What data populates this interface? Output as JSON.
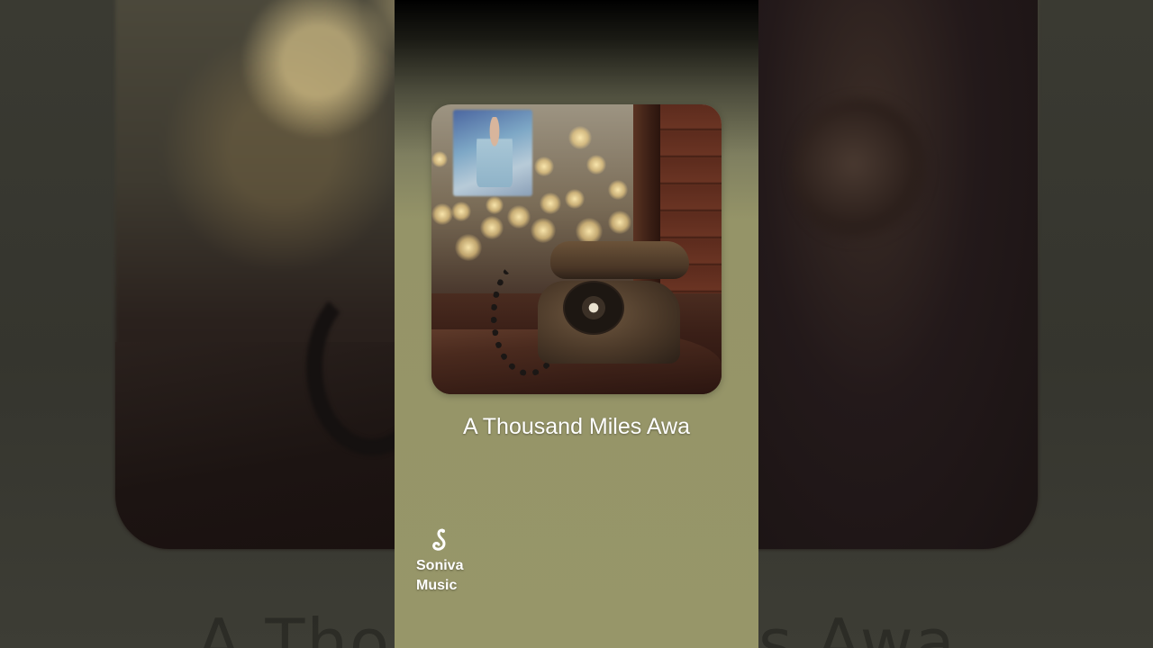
{
  "video": {
    "song_title": "A Thousand Miles Awa",
    "background_title": "A Thousand Miles Awa"
  },
  "brand": {
    "icon": "music-note-icon",
    "name": "Soniva\nMusic"
  },
  "colors": {
    "panel_bottom": "#979669",
    "panel_top": "#000000",
    "text": "#ffffff"
  }
}
